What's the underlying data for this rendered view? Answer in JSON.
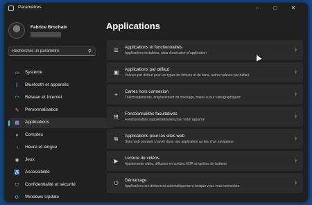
{
  "window": {
    "title": "Paramètres"
  },
  "user": {
    "name": "Fabrice Brochain"
  },
  "search": {
    "placeholder": "Rechercher un paramètre"
  },
  "sidebar": {
    "items": [
      {
        "label": "Système",
        "icon": "monitor-icon",
        "color": "#4cc2ff"
      },
      {
        "label": "Bluetooth et appareils",
        "icon": "bluetooth-icon",
        "color": "#4cc2ff"
      },
      {
        "label": "Réseau et Internet",
        "icon": "wifi-icon",
        "color": "#8fd3ff"
      },
      {
        "label": "Personnalisation",
        "icon": "brush-icon",
        "color": "#e8a060"
      },
      {
        "label": "Applications",
        "icon": "apps-icon",
        "color": "#a0b4ff",
        "active": true
      },
      {
        "label": "Comptes",
        "icon": "person-icon",
        "color": "#3cc47a"
      },
      {
        "label": "Heure et langue",
        "icon": "globe-clock-icon",
        "color": "#4cc2ff"
      },
      {
        "label": "Jeux",
        "icon": "gamepad-icon",
        "color": "#c8c8c8"
      },
      {
        "label": "Accessibilité",
        "icon": "accessibility-icon",
        "color": "#4cc2ff"
      },
      {
        "label": "Confidentialité et sécurité",
        "icon": "shield-icon",
        "color": "#a8a8a8"
      },
      {
        "label": "Windows Update",
        "icon": "update-icon",
        "color": "#4cc2ff"
      }
    ]
  },
  "main": {
    "title": "Applications",
    "rows": [
      {
        "title": "Applications et fonctionnalités",
        "subtitle": "Applications installées, alias d'exécution d'application",
        "icon": "apps-list-icon"
      },
      {
        "title": "Applications par défaut",
        "subtitle": "Valeurs par défaut pour les types de fichiers et de liens, autres valeurs par défaut",
        "icon": "default-apps-icon"
      },
      {
        "title": "Cartes hors connexion",
        "subtitle": "Téléchargements, emplacement de stockage, mises à jour cartographiques",
        "icon": "map-icon"
      },
      {
        "title": "Fonctionnalités facultatives",
        "subtitle": "Fonctionnalités supplémentaires pour votre appareil",
        "icon": "features-icon"
      },
      {
        "title": "Applications pour les sites web",
        "subtitle": "Sites web pouvant s'ouvrir dans une application au lieu d'un navigateur",
        "icon": "web-apps-icon"
      },
      {
        "title": "Lecture de vidéos",
        "subtitle": "Ajustements vidéo, diffusion en continu HDR et options de batterie",
        "icon": "video-icon"
      },
      {
        "title": "Démarrage",
        "subtitle": "Applications qui démarrent automatiquement lorsque vous vous connectez",
        "icon": "startup-icon"
      }
    ]
  },
  "colors": {
    "accent": "#4cc2ff",
    "background": "#202020",
    "card": "#2b2b2b"
  }
}
